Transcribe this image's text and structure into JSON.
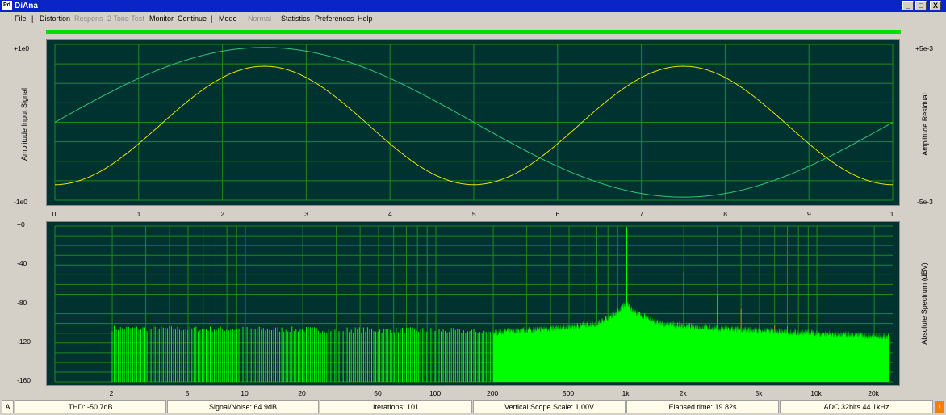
{
  "window": {
    "title": "DiAna",
    "icon": "diana-app-icon"
  },
  "controls": {
    "minimize": "_",
    "maximize": "□",
    "close": "X"
  },
  "menu": {
    "file": "File",
    "sep1": "|",
    "distortion": "Distortion",
    "respons": "Respons",
    "two_tone": "2 Tone Test",
    "monitor": "Monitor",
    "continue": "Continue",
    "sep2": "|",
    "mode": "Mode",
    "normal": "Normal",
    "statistics": "Statistics",
    "preferences": "Preferences",
    "help": "Help"
  },
  "progress": {
    "percent": 100,
    "color": "#00e000"
  },
  "scope": {
    "left_axis_label": "Amplitude Input Signal",
    "right_axis_label": "Amplitude Residual",
    "y_top_left": "+1e0",
    "y_bottom_left": "-1e0",
    "y_top_right": "+5e-3",
    "y_bottom_right": "-5e-3",
    "x_ticks": [
      "0",
      ".1",
      ".2",
      ".3",
      ".4",
      ".5",
      ".6",
      ".7",
      ".8",
      ".9",
      "1"
    ]
  },
  "spectrum": {
    "right_axis_label": "Absolute Spectrum (dBV)",
    "y_ticks": [
      "+0",
      "-40",
      "-80",
      "-120",
      "-160"
    ],
    "x_ticks": [
      "2",
      "5",
      "10",
      "20",
      "50",
      "100",
      "200",
      "500",
      "1k",
      "2k",
      "5k",
      "10k",
      "20k"
    ]
  },
  "chart_data": [
    {
      "type": "line",
      "title": "",
      "xlabel": "",
      "ylabel": "Amplitude Input Signal",
      "y2label": "Amplitude Residual",
      "xlim": [
        0,
        1
      ],
      "ylim": [
        -1,
        1
      ],
      "y2lim": [
        -0.005,
        0.005
      ],
      "grid": true,
      "series": [
        {
          "color": "#e6e600",
          "axis": "right",
          "shape": "sine",
          "cycles": 2,
          "amplitude": 0.0038,
          "phase_deg": 270,
          "offset": -0.0002
        },
        {
          "color": "#2ec87a",
          "axis": "left",
          "shape": "sine",
          "cycles": 1,
          "amplitude": 0.96,
          "phase_deg": 0,
          "offset": 0.0
        }
      ]
    },
    {
      "type": "area",
      "title": "",
      "xlabel": "",
      "ylabel": "Absolute Spectrum (dBV)",
      "x_scale": "log",
      "xlim": [
        1,
        25000
      ],
      "ylim": [
        -160,
        0
      ],
      "grid": true,
      "fundamental": {
        "freq": 1000,
        "level": -1
      },
      "noise_floor": [
        [
          2,
          -105
        ],
        [
          100,
          -107
        ],
        [
          200,
          -109
        ],
        [
          400,
          -105
        ],
        [
          700,
          -100
        ],
        [
          900,
          -88
        ],
        [
          1000,
          -78
        ],
        [
          1100,
          -88
        ],
        [
          1500,
          -100
        ],
        [
          3000,
          -105
        ],
        [
          10000,
          -110
        ],
        [
          20000,
          -113
        ]
      ],
      "harmonics": [
        {
          "freq": 2000,
          "level": -47
        },
        {
          "freq": 3000,
          "level": -70
        },
        {
          "freq": 4000,
          "level": -85
        },
        {
          "freq": 5000,
          "level": -100
        },
        {
          "freq": 6000,
          "level": -102
        },
        {
          "freq": 7000,
          "level": -103
        }
      ],
      "colors": {
        "spectrum": "#00ff00",
        "harmonics": "#d07830",
        "grid": "#1f8a1f",
        "background": "#00322f"
      }
    }
  ],
  "status": {
    "mode": "A",
    "thd": "THD: -50.7dB",
    "snr": "Signal/Noise:  64.9dB",
    "iterations": "Iterations: 101",
    "scope_scale": "Vertical Scope Scale: 1.00V",
    "elapsed": "Elapsed time: 19.82s",
    "adc": "ADC 32bits 44.1kHz",
    "warning": "!"
  }
}
